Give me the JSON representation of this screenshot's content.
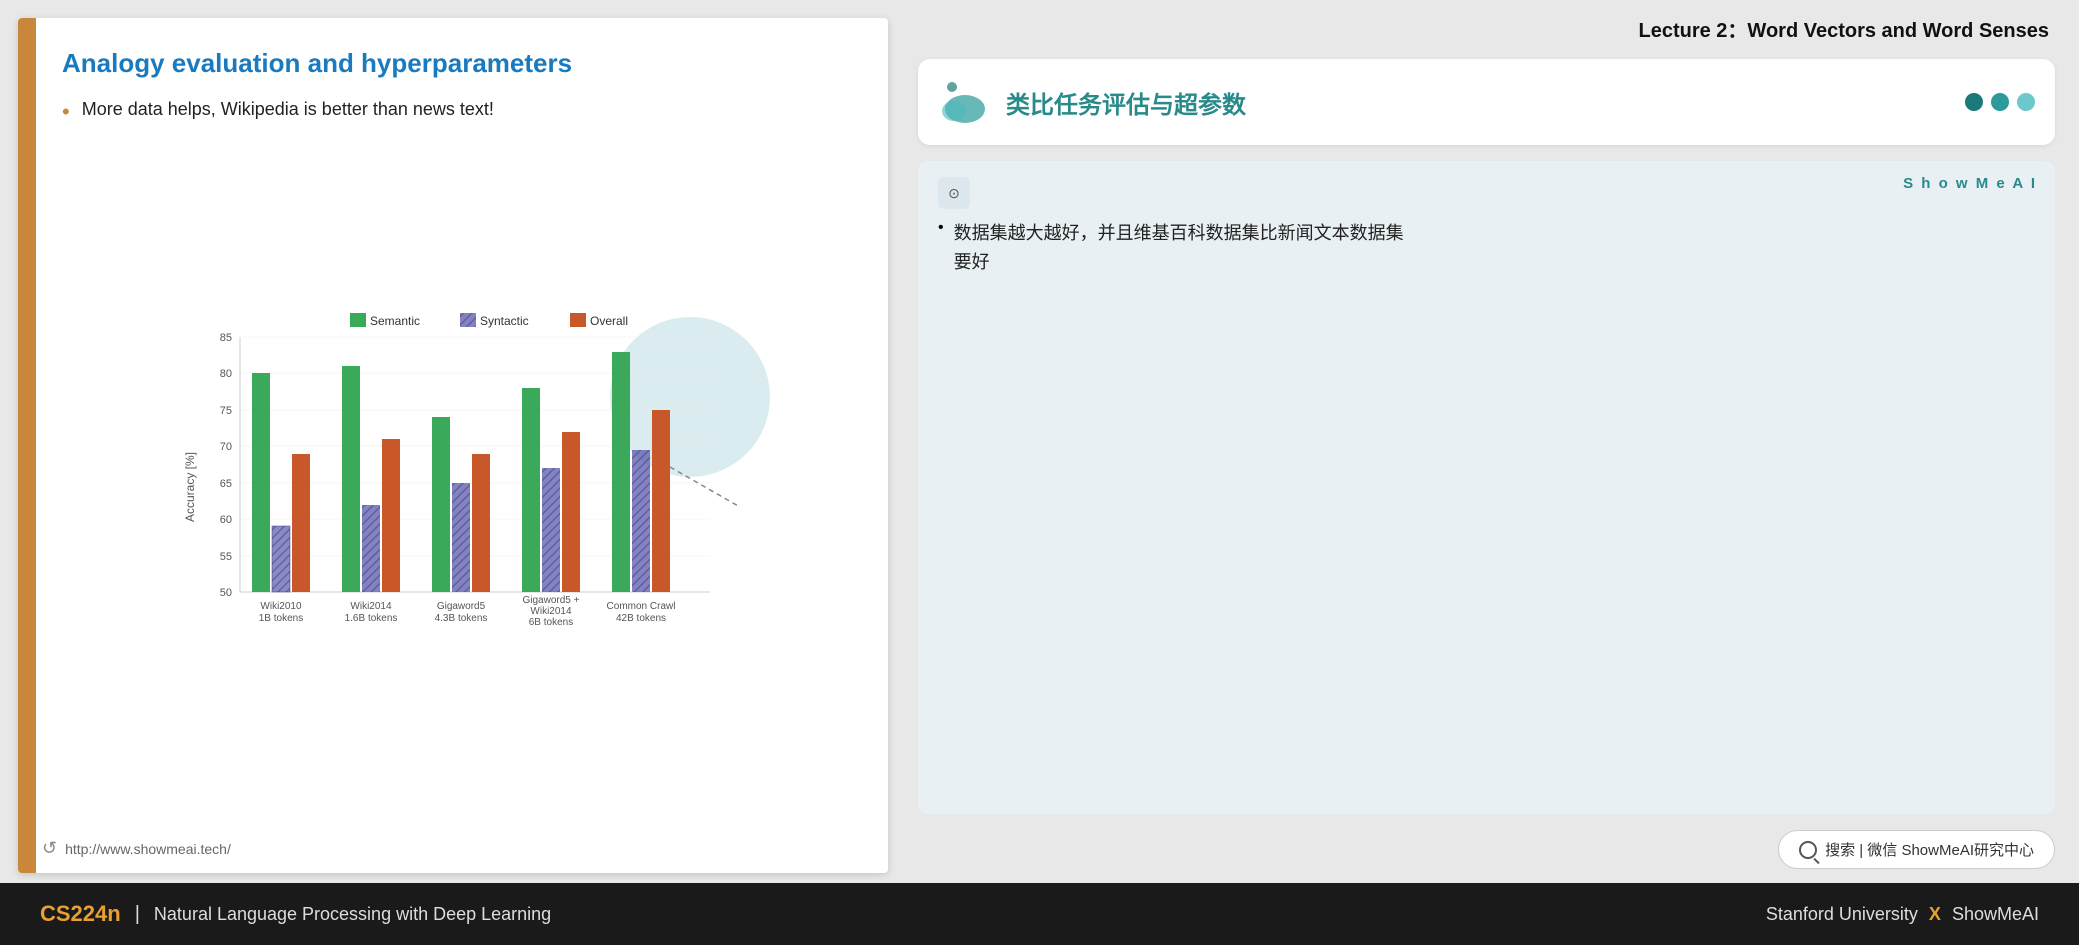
{
  "header": {
    "lecture_title": "Lecture 2：Word Vectors and Word Senses"
  },
  "slide": {
    "title": "Analogy evaluation and hyperparameters",
    "bullet": "More data helps, Wikipedia is better than news text!",
    "footer_url": "http://www.showmeai.tech/",
    "left_bar_color": "#c8873a"
  },
  "topic": {
    "title_cn": "类比任务评估与超参数",
    "dots": [
      {
        "color": "#1a7a7a"
      },
      {
        "color": "#2a9a9a"
      },
      {
        "color": "#6dc8cc"
      }
    ]
  },
  "translation": {
    "badge": "S h o w M e A I",
    "ai_icon": "⊙",
    "text_line1": "数据集越大越好，并且维基百科数据集比新闻文本数据集",
    "text_line2": "要好"
  },
  "chart": {
    "legend": [
      {
        "label": "Semantic",
        "color": "#3aaa5a",
        "pattern": "solid"
      },
      {
        "label": "Syntactic",
        "color": "#5a5aaa",
        "pattern": "hatch"
      },
      {
        "label": "Overall",
        "color": "#c8572a",
        "pattern": "solid"
      }
    ],
    "y_axis": {
      "label": "Accuracy [%]",
      "ticks": [
        50,
        55,
        60,
        65,
        70,
        75,
        80,
        85
      ]
    },
    "groups": [
      {
        "label": "Wiki2010",
        "sublabel": "1B tokens",
        "bars": [
          {
            "type": "Semantic",
            "value": 80
          },
          {
            "type": "Syntactic",
            "value": 59
          },
          {
            "type": "Overall",
            "value": 69
          }
        ]
      },
      {
        "label": "Wiki2014",
        "sublabel": "1.6B tokens",
        "bars": [
          {
            "type": "Semantic",
            "value": 81
          },
          {
            "type": "Syntactic",
            "value": 62
          },
          {
            "type": "Overall",
            "value": 71
          }
        ]
      },
      {
        "label": "Gigaword5",
        "sublabel": "4.3B tokens",
        "bars": [
          {
            "type": "Semantic",
            "value": 74
          },
          {
            "type": "Syntactic",
            "value": 65
          },
          {
            "type": "Overall",
            "value": 69
          }
        ]
      },
      {
        "label": "Gigaword5 +",
        "sublabel2": "Wiki2014",
        "sublabel3": "6B tokens",
        "bars": [
          {
            "type": "Semantic",
            "value": 77.5
          },
          {
            "type": "Syntactic",
            "value": 67
          },
          {
            "type": "Overall",
            "value": 72
          }
        ]
      },
      {
        "label": "Common Crawl",
        "sublabel": "42B tokens",
        "bars": [
          {
            "type": "Semantic",
            "value": 83
          },
          {
            "type": "Syntactic",
            "value": 69.5
          },
          {
            "type": "Overall",
            "value": 75
          }
        ]
      }
    ]
  },
  "search": {
    "text": "搜索 | 微信 ShowMeAI研究中心"
  },
  "footer": {
    "cs224n": "CS224n",
    "divider": "|",
    "course_name": "Natural Language Processing with Deep Learning",
    "university": "Stanford University",
    "x": "X",
    "brand": "ShowMeAI"
  }
}
